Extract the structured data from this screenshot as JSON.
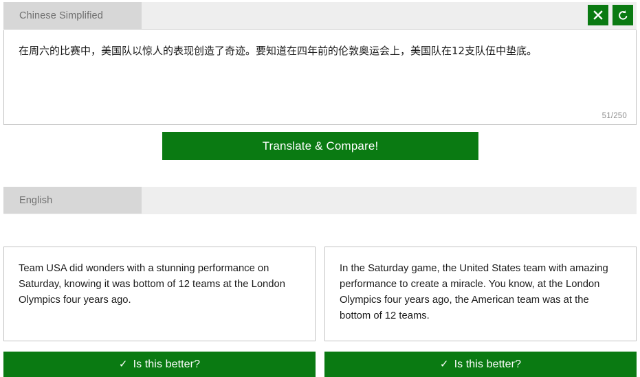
{
  "source_panel": {
    "tab_label": "Chinese Simplified",
    "text": "在周六的比赛中，美国队以惊人的表现创造了奇迹。要知道在四年前的伦敦奥运会上，美国队在12支队伍中垫底。",
    "char_counter": "51/250",
    "clear_button": {
      "icon": "close-icon",
      "title": "Clear"
    },
    "reset_button": {
      "icon": "reset-icon",
      "title": "Reset"
    }
  },
  "translate_button": {
    "label": "Translate & Compare!"
  },
  "target_panel": {
    "tab_label": "English"
  },
  "results": [
    {
      "text": "Team USA did wonders with a stunning performance on Saturday, knowing it was bottom of 12 teams at the London Olympics four years ago.",
      "vote_label": "Is this better?",
      "vote_icon": "check-icon"
    },
    {
      "text": "In the Saturday game, the United States team with amazing performance to create a miracle. You know, at the London Olympics four years ago, the American team was at the bottom of 12 teams.",
      "vote_label": "Is this better?",
      "vote_icon": "check-icon"
    }
  ],
  "colors": {
    "accent_green": "#0a7a12",
    "tab_active_bg": "#d7d7d7",
    "tab_strip_bg": "#eeeeee",
    "border": "#c2c2c2"
  },
  "glyphs": {
    "check": "✓"
  }
}
